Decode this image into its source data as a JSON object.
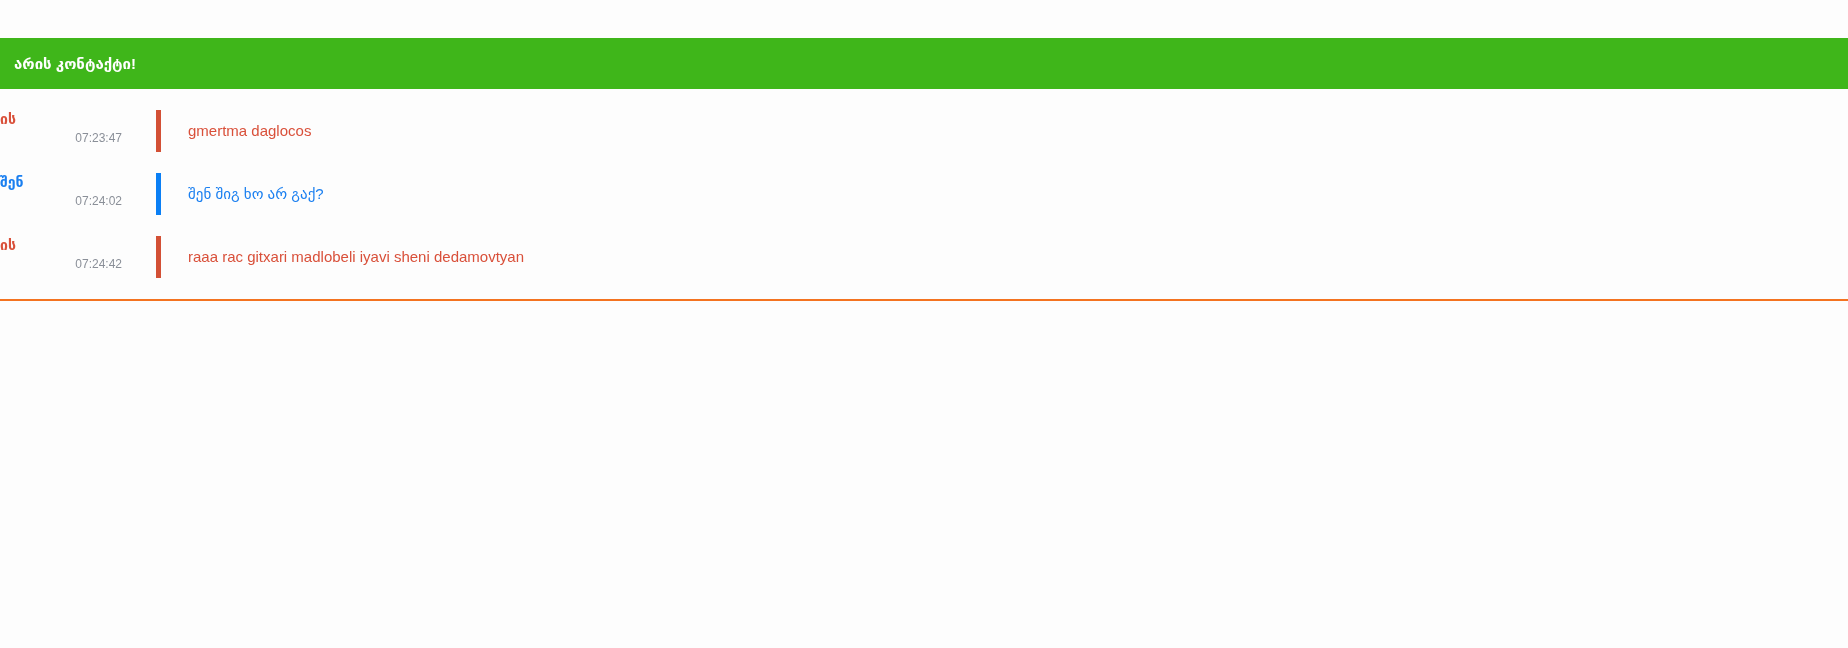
{
  "header": {
    "title": "არის კონტაქტი!"
  },
  "messages": [
    {
      "kind": "them",
      "sender": "ის",
      "time": "07:23:47",
      "text": "gmertma daglocos"
    },
    {
      "kind": "me",
      "sender": "შენ",
      "time": "07:24:02",
      "text": "შენ შიგ ხო არ გაქ?"
    },
    {
      "kind": "them",
      "sender": "ის",
      "time": "07:24:42",
      "text": "raaa rac gitxari madlobeli iyavi sheni dedamovtyan"
    }
  ]
}
